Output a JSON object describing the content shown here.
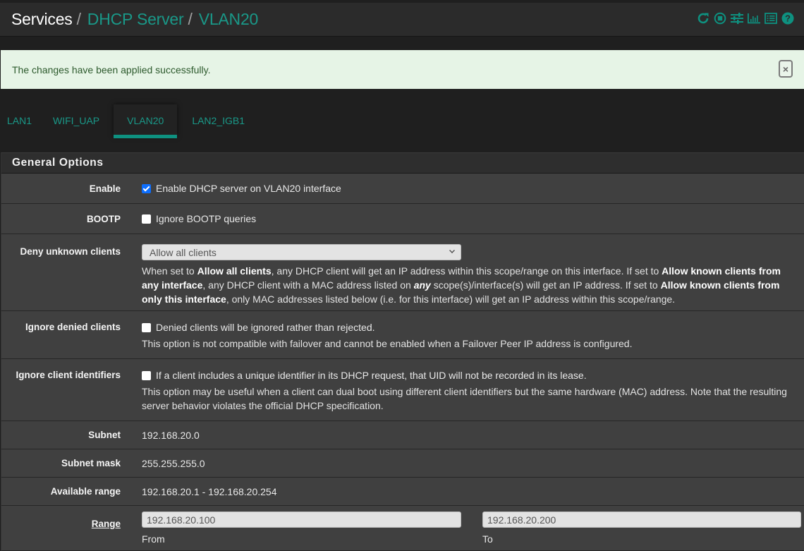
{
  "header": {
    "breadcrumb": [
      {
        "label": "Services",
        "link": false
      },
      {
        "label": "DHCP Server",
        "link": true
      },
      {
        "label": "VLAN20",
        "link": true
      }
    ],
    "separator": "/",
    "icons": [
      "reload-icon",
      "stop-service-icon",
      "settings-sliders-icon",
      "status-chart-icon",
      "log-list-icon",
      "help-icon"
    ],
    "accent_color": "#1a9888"
  },
  "alert": {
    "message": "The changes have been applied successfully.",
    "close_label": "×"
  },
  "tabs": [
    {
      "label": "LAN1",
      "active": false
    },
    {
      "label": "WIFI_UAP",
      "active": false
    },
    {
      "label": "VLAN20",
      "active": true
    },
    {
      "label": "LAN2_IGB1",
      "active": false
    }
  ],
  "panel": {
    "title": "General Options",
    "enable": {
      "label": "Enable",
      "checked": true,
      "text": "Enable DHCP server on VLAN20 interface"
    },
    "bootp": {
      "label": "BOOTP",
      "checked": false,
      "text": "Ignore BOOTP queries"
    },
    "deny_unknown": {
      "label": "Deny unknown clients",
      "selected": "Allow all clients",
      "help": {
        "p1": "When set to ",
        "b1": "Allow all clients",
        "p2": ", any DHCP client will get an IP address within this scope/range on this interface. If set to ",
        "b2": "Allow known clients from any interface",
        "p3": ", any DHCP client with a MAC address listed on ",
        "b3": "any",
        "p4": " scope(s)/interface(s) will get an IP address. If set to ",
        "b4": "Allow known clients from only this interface",
        "p5": ", only MAC addresses listed below (i.e. for this interface) will get an IP address within this scope/range."
      }
    },
    "ignore_denied": {
      "label": "Ignore denied clients",
      "checked": false,
      "text": "Denied clients will be ignored rather than rejected.",
      "help": "This option is not compatible with failover and cannot be enabled when a Failover Peer IP address is configured."
    },
    "ignore_client_ids": {
      "label": "Ignore client identifiers",
      "checked": false,
      "text": "If a client includes a unique identifier in its DHCP request, that UID will not be recorded in its lease.",
      "help": "This option may be useful when a client can dual boot using different client identifiers but the same hardware (MAC) address. Note that the resulting server behavior violates the official DHCP specification."
    },
    "subnet": {
      "label": "Subnet",
      "value": "192.168.20.0"
    },
    "subnet_mask": {
      "label": "Subnet mask",
      "value": "255.255.255.0"
    },
    "available_range": {
      "label": "Available range",
      "value": "192.168.20.1 - 192.168.20.254"
    },
    "range": {
      "label": "Range",
      "from_value": "192.168.20.100",
      "from_label": "From",
      "to_value": "192.168.20.200",
      "to_label": "To"
    }
  }
}
